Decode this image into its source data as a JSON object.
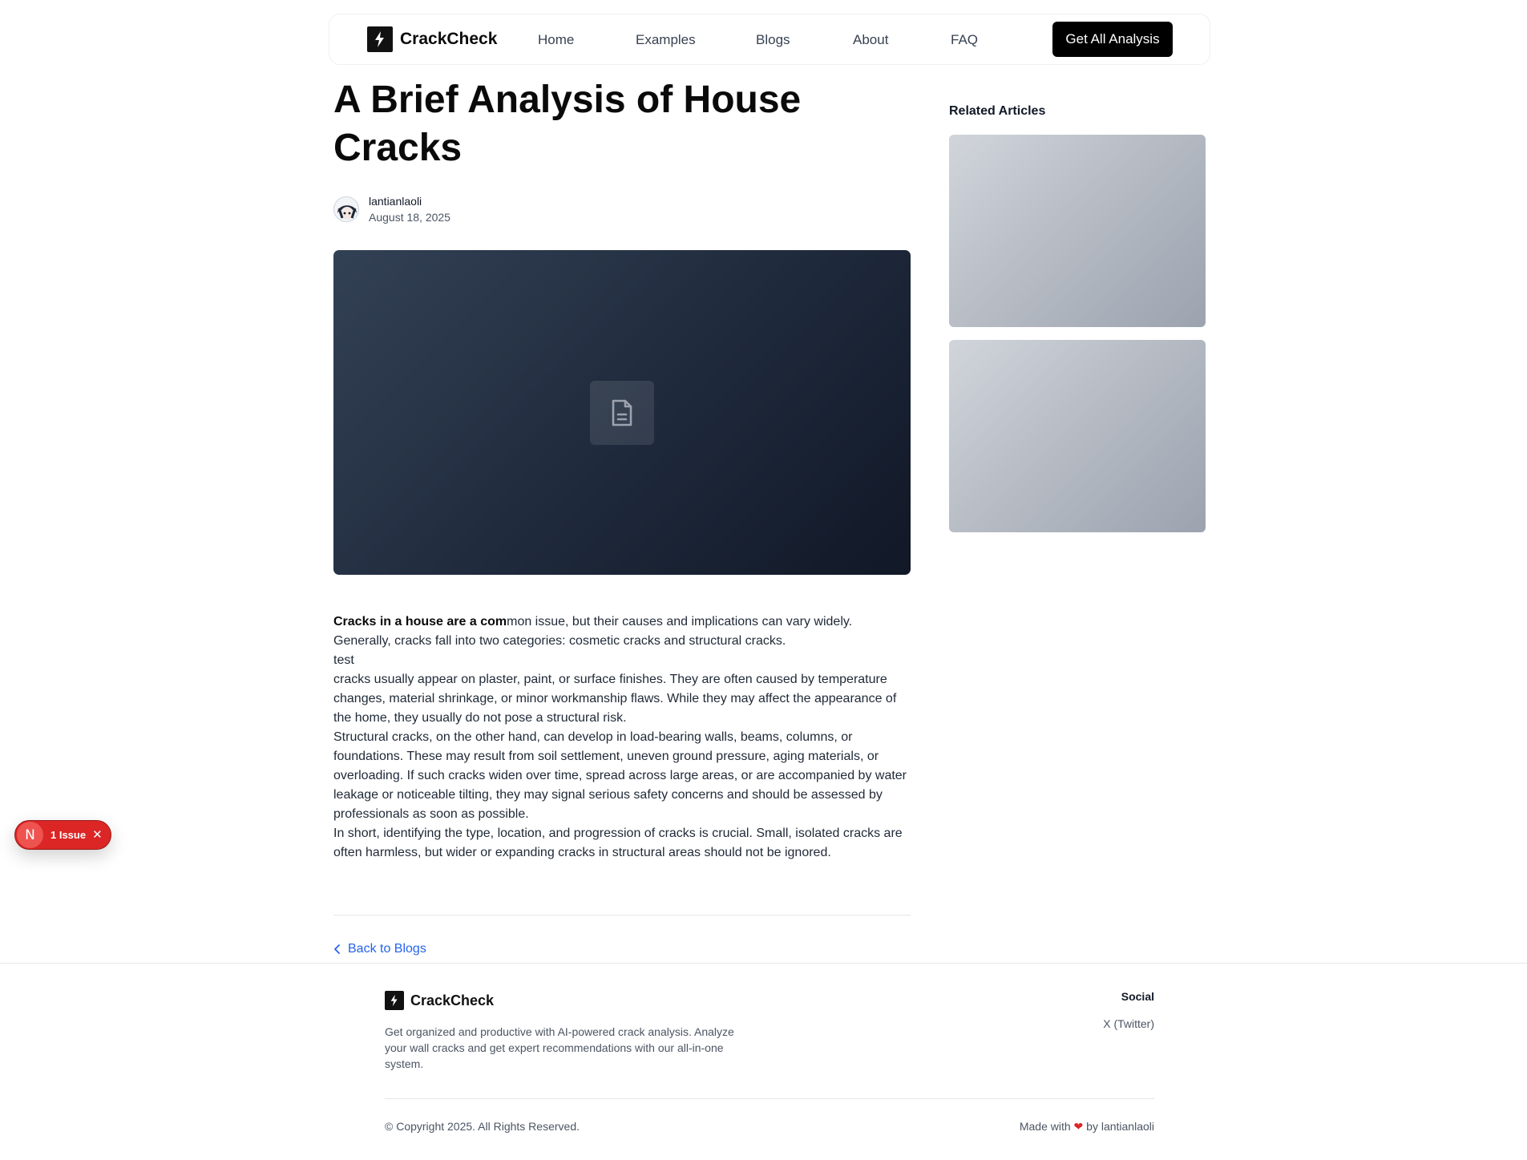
{
  "nav": {
    "brand": "CrackCheck",
    "links": [
      "Home",
      "Examples",
      "Blogs",
      "About",
      "FAQ"
    ],
    "cta": "Get All Analysis"
  },
  "article": {
    "title": "A Brief Analysis of House Cracks",
    "author": "lantianlaoli",
    "date": "August 18, 2025",
    "lead_bold": "Cracks in a house are a com",
    "lead_rest": "mon issue, but their causes and implications can vary widely. Generally, cracks fall into two categories: cosmetic cracks and structural cracks.",
    "paragraphs": [
      "test",
      "cracks usually appear on plaster, paint, or surface finishes. They are often caused by temperature changes, material shrinkage, or minor workmanship flaws. While they may affect the appearance of the home, they usually do not pose a structural risk.",
      "Structural cracks, on the other hand, can develop in load-bearing walls, beams, columns, or foundations. These may result from soil settlement, uneven ground pressure, aging materials, or overloading. If such cracks widen over time, spread across large areas, or are accompanied by water leakage or noticeable tilting, they may signal serious safety concerns and should be assessed by professionals as soon as possible.",
      "In short, identifying the type, location, and progression of cracks is crucial. Small, isolated cracks are often harmless, but wider or expanding cracks in structural areas should not be ignored."
    ],
    "back_label": "Back to Blogs",
    "hero_icon": "document-icon"
  },
  "sidebar": {
    "heading": "Related Articles",
    "cards": [
      "related-card-1",
      "related-card-2"
    ]
  },
  "issue_badge": {
    "letter": "N",
    "label": "1 Issue"
  },
  "footer": {
    "brand": "CrackCheck",
    "description": "Get organized and productive with AI-powered crack analysis. Analyze your wall cracks and get expert recommendations with our all-in-one system.",
    "social_heading": "Social",
    "social_link": "X (Twitter)",
    "copyright": "© Copyright 2025. All Rights Reserved.",
    "made_prefix": "Made with",
    "heart": "❤",
    "made_suffix": "by lantianlaoli"
  },
  "colors": {
    "accent_link": "#2563eb",
    "cta_bg": "#000000",
    "issue_red": "#dc2626",
    "heart": "#dc2626"
  }
}
